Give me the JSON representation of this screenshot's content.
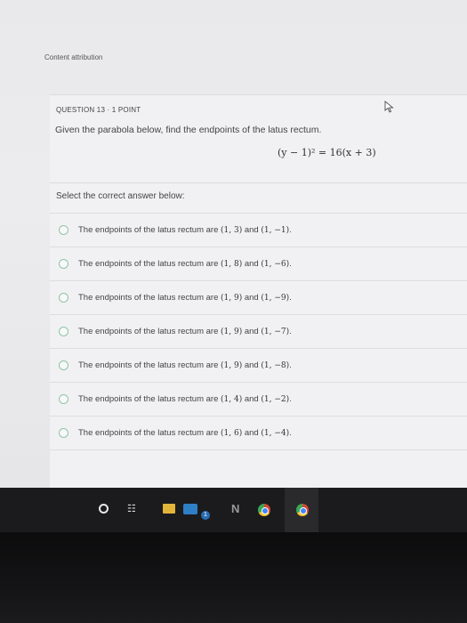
{
  "page": {
    "attribution": "Content attribution"
  },
  "question": {
    "header": "QUESTION 13 · 1 POINT",
    "prompt": "Given the parabola below, find the endpoints of the latus rectum.",
    "equation": "(y − 1)² = 16(x + 3)",
    "select_label": "Select the correct answer below:"
  },
  "options": [
    {
      "prefix": "The endpoints of the latus rectum are ",
      "p1": "(1, 3)",
      "mid": " and ",
      "p2": "(1, −1)",
      "end": "."
    },
    {
      "prefix": "The endpoints of the latus rectum are ",
      "p1": "(1, 8)",
      "mid": " and ",
      "p2": "(1, −6)",
      "end": "."
    },
    {
      "prefix": "The endpoints of the latus rectum are ",
      "p1": "(1, 9)",
      "mid": " and ",
      "p2": "(1, −9)",
      "end": "."
    },
    {
      "prefix": "The endpoints of the latus rectum are ",
      "p1": "(1, 9)",
      "mid": " and ",
      "p2": "(1, −7)",
      "end": "."
    },
    {
      "prefix": "The endpoints of the latus rectum are ",
      "p1": "(1, 9)",
      "mid": " and ",
      "p2": "(1, −8)",
      "end": "."
    },
    {
      "prefix": "The endpoints of the latus rectum are ",
      "p1": "(1, 4)",
      "mid": " and ",
      "p2": "(1, −2)",
      "end": "."
    },
    {
      "prefix": "The endpoints of the latus rectum are ",
      "p1": "(1, 6)",
      "mid": " and ",
      "p2": "(1, −4)",
      "end": "."
    }
  ],
  "taskbar": {
    "icons": [
      "cortana-circle-icon",
      "task-view-icon",
      "file-explorer-icon",
      "store-icon",
      "onenote-icon",
      "chrome-icon",
      "chrome-icon"
    ],
    "badge": "1",
    "n_glyph": "N",
    "task_glyph": "☷"
  },
  "colors": {
    "radio_border": "#8fc5a5",
    "screen_bg": "#ececee",
    "taskbar_bg": "#1b1b1d"
  }
}
